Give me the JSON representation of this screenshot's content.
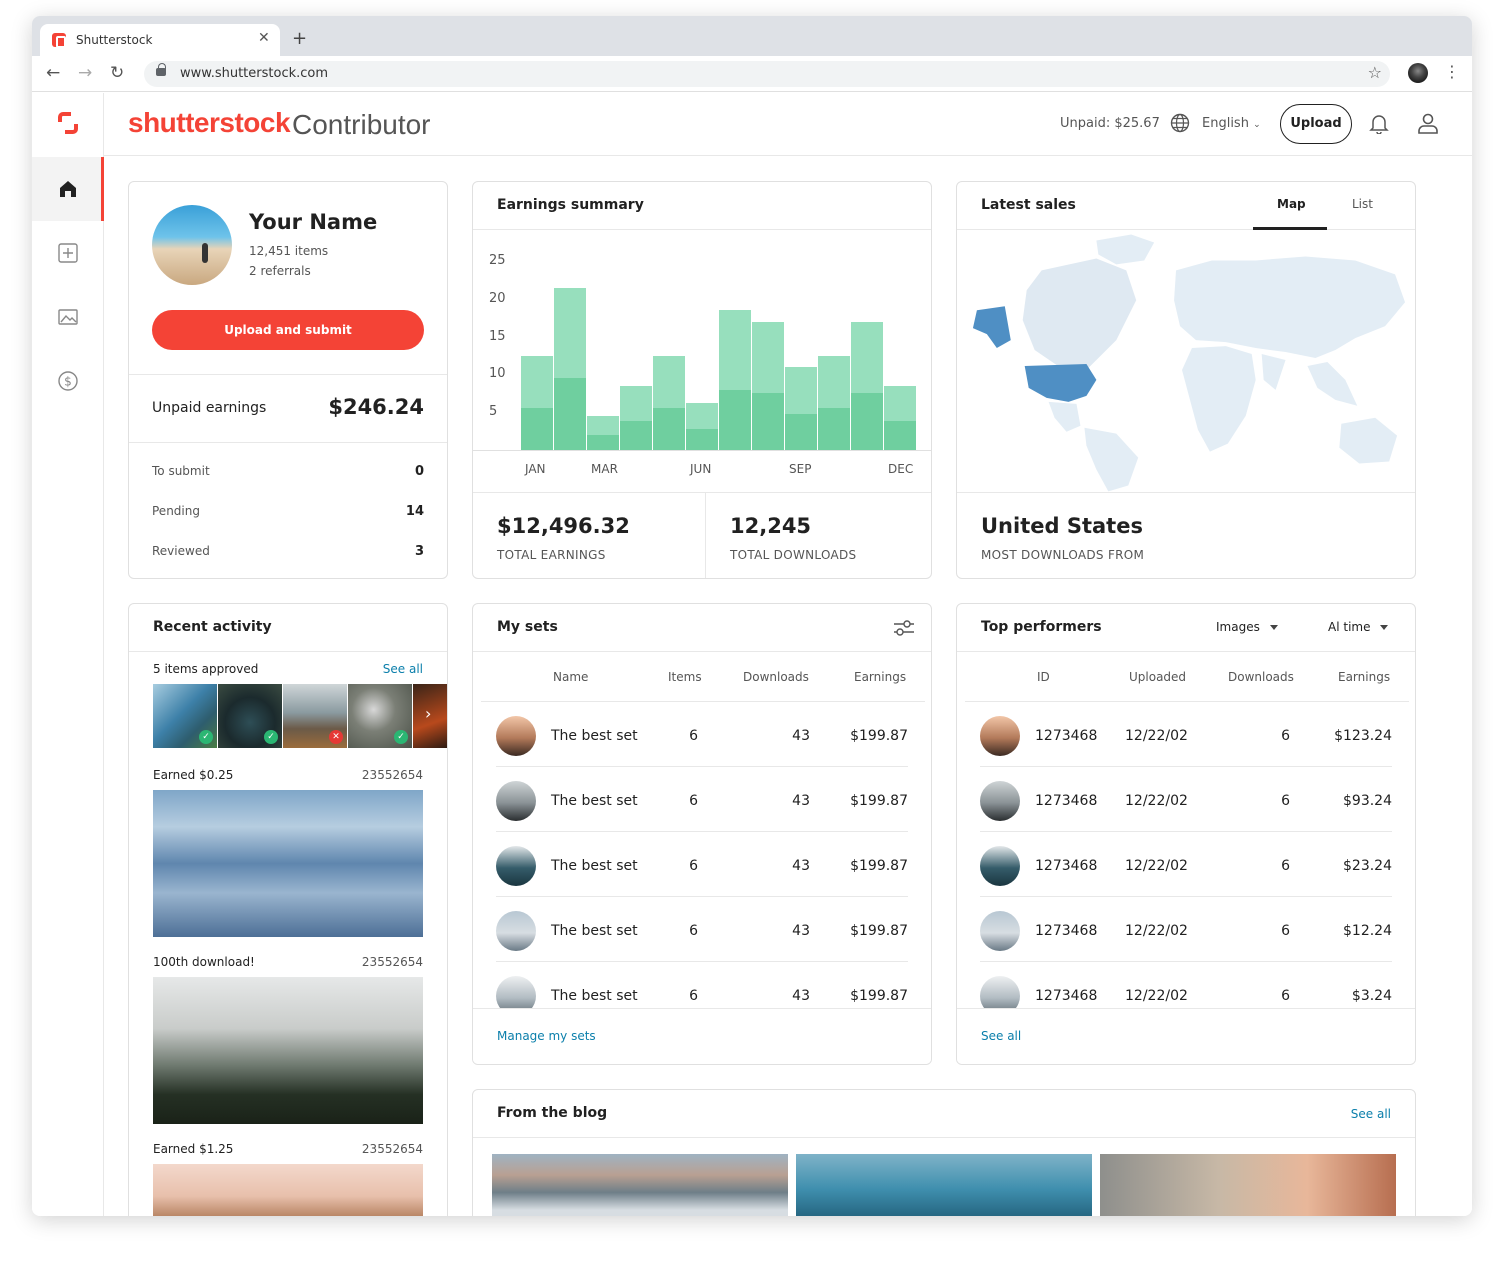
{
  "browser": {
    "tab_title": "Shutterstock",
    "url": "www.shutterstock.com"
  },
  "header": {
    "brand": "shutterstock",
    "product": "Contributor",
    "unpaid": "Unpaid: $25.67",
    "language": "English",
    "upload": "Upload"
  },
  "profile": {
    "name": "Your Name",
    "items": "12,451 items",
    "referrals": "2 referrals",
    "cta": "Upload and submit",
    "unpaid_label": "Unpaid earnings",
    "unpaid_value": "$246.24",
    "rows": [
      {
        "label": "To submit",
        "value": "0"
      },
      {
        "label": "Pending",
        "value": "14"
      },
      {
        "label": "Reviewed",
        "value": "3"
      }
    ]
  },
  "earnings": {
    "title": "Earnings summary",
    "total_earnings": "$12,496.32",
    "total_earnings_label": "TOTAL EARNINGS",
    "total_downloads": "12,245",
    "total_downloads_label": "TOTAL DOWNLOADS"
  },
  "chart_data": {
    "type": "bar",
    "stacked": true,
    "categories": [
      "JAN",
      "FEB",
      "MAR",
      "APR",
      "MAY",
      "JUN",
      "JUL",
      "AUG",
      "SEP",
      "OCT",
      "NOV",
      "DEC"
    ],
    "tick_labels": [
      "JAN",
      "",
      "MAR",
      "",
      "",
      "JUN",
      "",
      "",
      "SEP",
      "",
      "",
      "DEC"
    ],
    "series": [
      {
        "values": [
          5.5,
          9.5,
          2,
          3.8,
          5.5,
          2.8,
          8,
          7.5,
          4.8,
          5.5,
          7.5,
          3.8
        ]
      },
      {
        "values": [
          12.5,
          21.5,
          4.5,
          8.5,
          12.5,
          6.2,
          18.5,
          17,
          11,
          12.5,
          17,
          8.5
        ]
      }
    ],
    "yticks": [
      5,
      10,
      15,
      20,
      25
    ],
    "ylim": [
      0,
      27
    ],
    "colors": [
      "#6fcf9f",
      "#97dfbd"
    ]
  },
  "sales": {
    "title": "Latest sales",
    "tab_map": "Map",
    "tab_list": "List",
    "country": "United States",
    "country_label": "MOST DOWNLOADS FROM"
  },
  "activity": {
    "title": "Recent activity",
    "approved": "5 items approved",
    "see_all": "See all",
    "thumbs": [
      {
        "status": "ok"
      },
      {
        "status": "ok"
      },
      {
        "status": "rejected"
      },
      {
        "status": "ok"
      },
      {
        "status": "more"
      }
    ],
    "items": [
      {
        "label": "Earned $0.25",
        "id": "23552654"
      },
      {
        "label": "100th download!",
        "id": "23552654"
      },
      {
        "label": "Earned $1.25",
        "id": "23552654"
      }
    ]
  },
  "sets": {
    "title": "My sets",
    "cols": [
      "Name",
      "Items",
      "Downloads",
      "Earnings"
    ],
    "rows": [
      {
        "name": "The best set",
        "items": "6",
        "downloads": "43",
        "earnings": "$199.87"
      },
      {
        "name": "The best set",
        "items": "6",
        "downloads": "43",
        "earnings": "$199.87"
      },
      {
        "name": "The best set",
        "items": "6",
        "downloads": "43",
        "earnings": "$199.87"
      },
      {
        "name": "The best set",
        "items": "6",
        "downloads": "43",
        "earnings": "$199.87"
      },
      {
        "name": "The best set",
        "items": "6",
        "downloads": "43",
        "earnings": "$199.87"
      }
    ],
    "footer": "Manage my sets"
  },
  "top": {
    "title": "Top performers",
    "filter_type": "Images",
    "filter_time": "Al time",
    "cols": [
      "ID",
      "Uploaded",
      "Downloads",
      "Earnings"
    ],
    "rows": [
      {
        "id": "1273468",
        "uploaded": "12/22/02",
        "downloads": "6",
        "earnings": "$123.24"
      },
      {
        "id": "1273468",
        "uploaded": "12/22/02",
        "downloads": "6",
        "earnings": "$93.24"
      },
      {
        "id": "1273468",
        "uploaded": "12/22/02",
        "downloads": "6",
        "earnings": "$23.24"
      },
      {
        "id": "1273468",
        "uploaded": "12/22/02",
        "downloads": "6",
        "earnings": "$12.24"
      },
      {
        "id": "1273468",
        "uploaded": "12/22/02",
        "downloads": "6",
        "earnings": "$3.24"
      }
    ],
    "footer": "See all"
  },
  "blog": {
    "title": "From the blog",
    "see_all": "See all"
  }
}
